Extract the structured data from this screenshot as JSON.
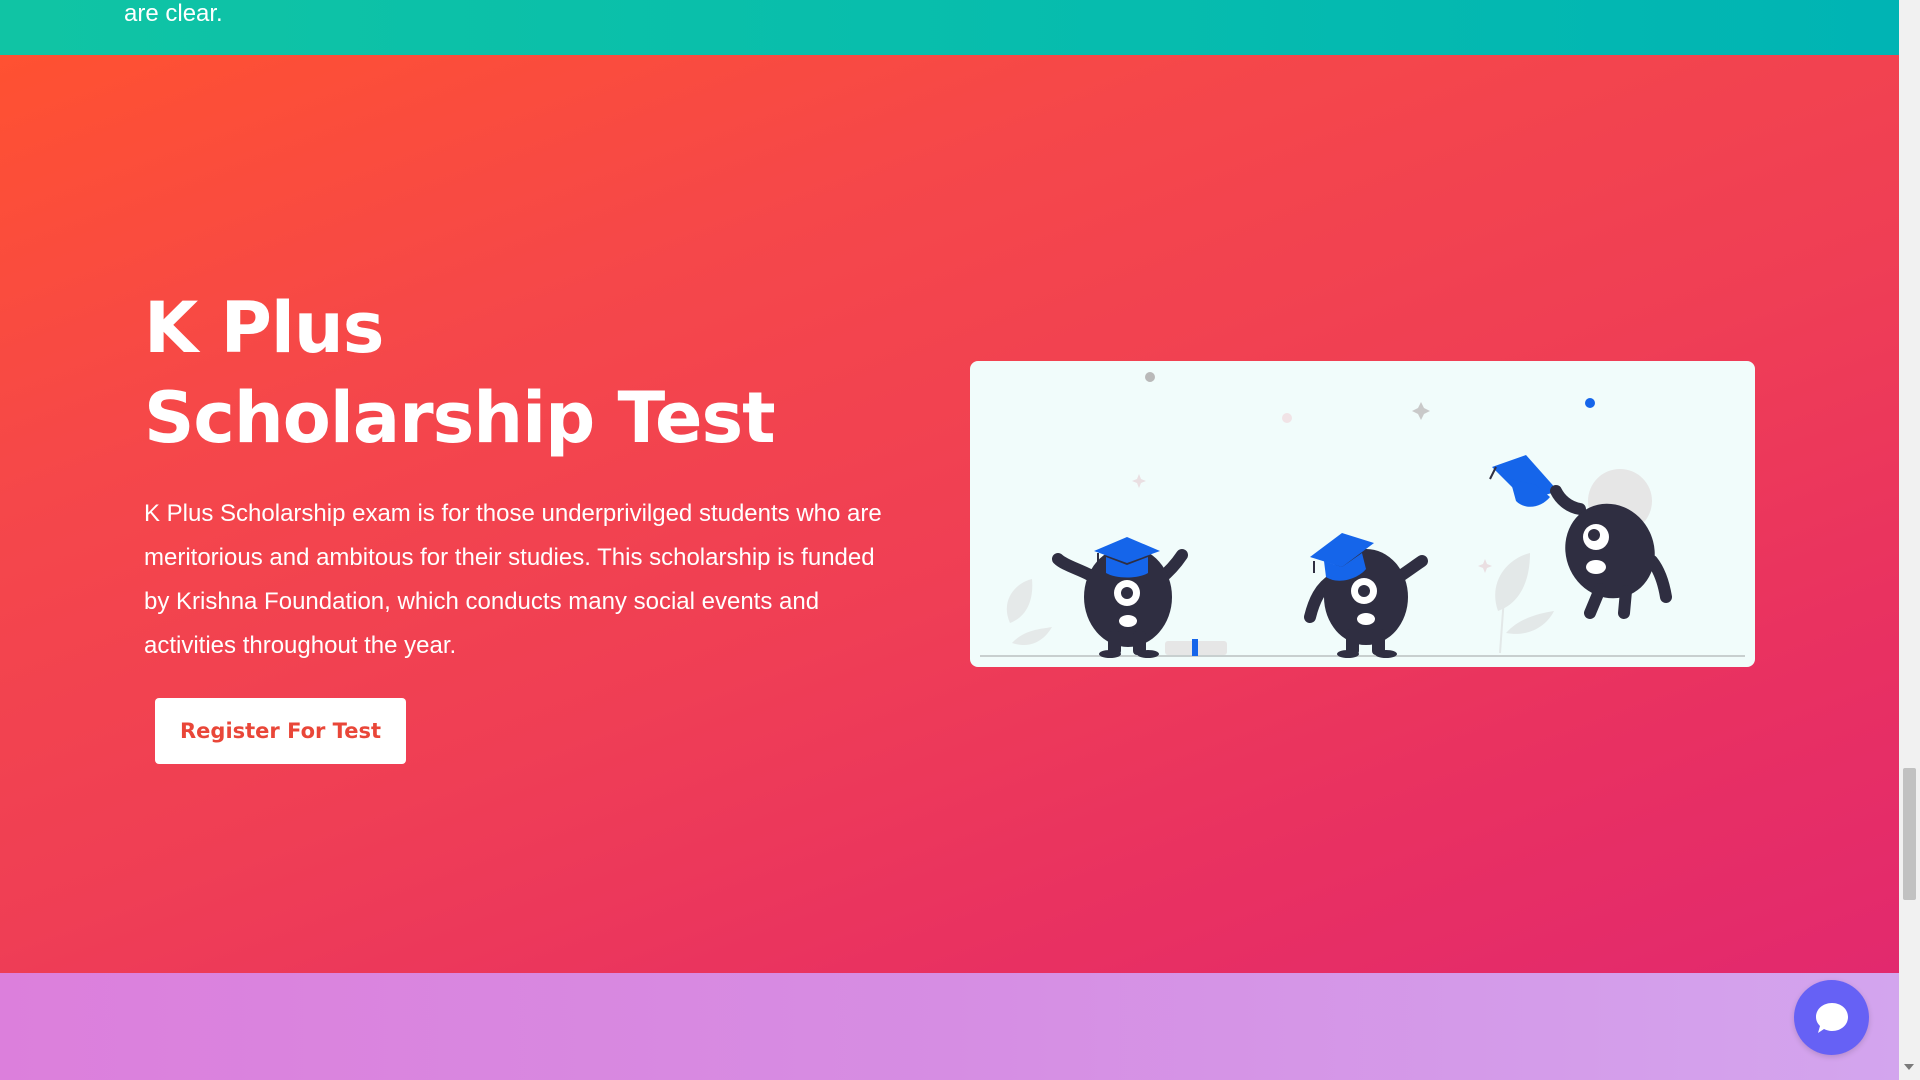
{
  "previous_section": {
    "trailing_text": "are clear."
  },
  "hero": {
    "title_line1": "K Plus",
    "title_line2": "Scholarship Test",
    "description": "K Plus Scholarship exam is for those underprivilged students who are meritorious and ambitous for their studies. This scholarship is funded by Krishna Foundation, which conducts many social events and activities throughout the year.",
    "register_button_label": "Register For Test",
    "illustration_icon": "graduation-characters-illustration"
  },
  "chat_widget": {
    "icon": "chat-bubble-icon"
  },
  "colors": {
    "hero_gradient_start": "#ff5131",
    "hero_gradient_end": "#e2296e",
    "top_band": "#06bcae",
    "bottom_band": "#d68de3",
    "button_text": "#e94638",
    "chat_button": "#6661f5",
    "cap_blue": "#1565ea",
    "character_dark": "#2f2e41"
  }
}
